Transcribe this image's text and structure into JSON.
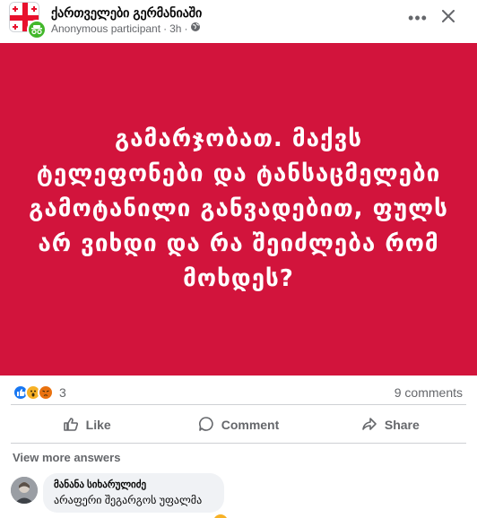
{
  "post": {
    "group_name": "ქართველები გერმანიაში",
    "author": "Anonymous participant",
    "separator": "·",
    "time": "3h",
    "privacy_icon": "globe-icon",
    "group_icon": "georgian-flag-icon",
    "badge_icon": "anonymous-icon",
    "more_label": "•••",
    "close_icon": "close-icon",
    "body_text": "გამარჯობათ. მაქვს ტელეფონები და ტანსაცმელები გამოტანილი განვადებით, ფულს არ ვიხდი და რა შეიძლება რომ მოხდეს?",
    "background_color": "#d2143c"
  },
  "stats": {
    "reaction_count": "3",
    "reaction_icons": [
      "like-icon",
      "wow-icon",
      "angry-icon"
    ],
    "comments": "9 comments"
  },
  "actions": {
    "like": "Like",
    "comment": "Comment",
    "share": "Share"
  },
  "comments": {
    "view_more": "View more answers",
    "items": [
      {
        "name": "მანანა სიხარულიძე",
        "text": "არაფერი შეგარგოს უფალმა"
      }
    ]
  }
}
